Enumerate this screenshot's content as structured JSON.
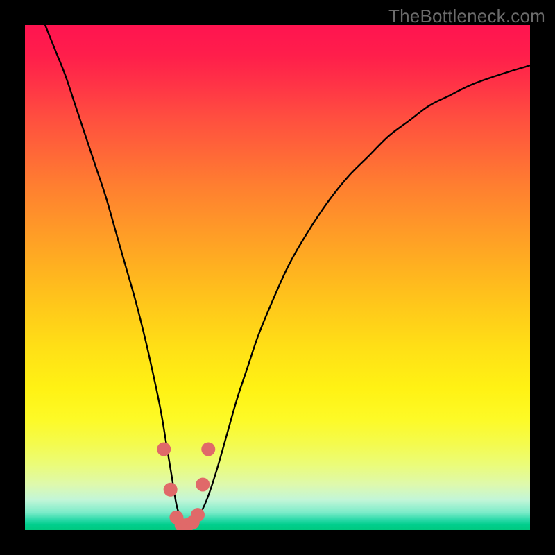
{
  "watermark": "TheBottleneck.com",
  "chart_data": {
    "type": "line",
    "title": "",
    "xlabel": "",
    "ylabel": "",
    "xlim": [
      0,
      100
    ],
    "ylim": [
      0,
      100
    ],
    "series": [
      {
        "name": "curve",
        "x": [
          4,
          6,
          8,
          10,
          12,
          14,
          16,
          18,
          20,
          22,
          24,
          26,
          27,
          28,
          29,
          30,
          31,
          32,
          33,
          34,
          36,
          38,
          40,
          42,
          44,
          46,
          48,
          52,
          56,
          60,
          64,
          68,
          72,
          76,
          80,
          84,
          88,
          92,
          96,
          100
        ],
        "y": [
          100,
          95,
          90,
          84,
          78,
          72,
          66,
          59,
          52,
          45,
          37,
          28,
          23,
          17,
          11,
          5,
          2,
          1,
          1,
          2,
          6,
          12,
          19,
          26,
          32,
          38,
          43,
          52,
          59,
          65,
          70,
          74,
          78,
          81,
          84,
          86,
          88,
          89.5,
          90.8,
          92
        ]
      },
      {
        "name": "markers",
        "x": [
          27.5,
          28.8,
          30.0,
          31.0,
          32.2,
          33.2,
          34.2,
          35.2,
          36.3
        ],
        "y": [
          16,
          8,
          2.5,
          1,
          1,
          1.5,
          3,
          9,
          16
        ]
      }
    ],
    "curve_stroke": "#000000",
    "marker_color": "#e06969",
    "gradient_top": "#ff1450",
    "gradient_bottom": "#00c97f"
  }
}
